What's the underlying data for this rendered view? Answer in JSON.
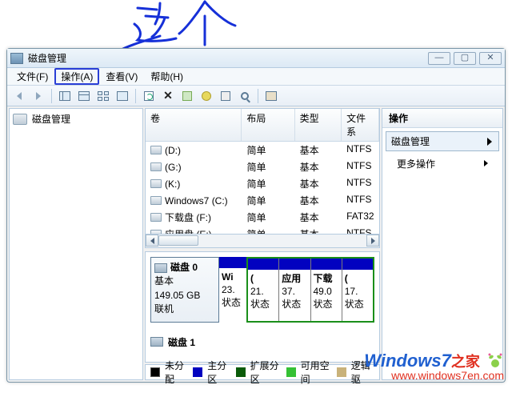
{
  "annotation_text": "这个",
  "window": {
    "title": "磁盘管理",
    "menu": {
      "file": "文件(F)",
      "action": "操作(A)",
      "view": "查看(V)",
      "help": "帮助(H)"
    },
    "tree": {
      "root": "磁盘管理"
    },
    "table": {
      "headers": {
        "volume": "卷",
        "layout": "布局",
        "type": "类型",
        "fs": "文件系"
      },
      "rows": [
        {
          "name": "(D:)",
          "layout": "简单",
          "type": "基本",
          "fs": "NTFS"
        },
        {
          "name": "(G:)",
          "layout": "简单",
          "type": "基本",
          "fs": "NTFS"
        },
        {
          "name": "(K:)",
          "layout": "简单",
          "type": "基本",
          "fs": "NTFS"
        },
        {
          "name": "Windows7 (C:)",
          "layout": "简单",
          "type": "基本",
          "fs": "NTFS"
        },
        {
          "name": "下载盘 (F:)",
          "layout": "简单",
          "type": "基本",
          "fs": "FAT32"
        },
        {
          "name": "应用盘 (E:)",
          "layout": "简单",
          "type": "基本",
          "fs": "NTFS"
        }
      ]
    },
    "disk0": {
      "label": "磁盘 0",
      "kind": "基本",
      "size": "149.05 GB",
      "status": "联机",
      "parts": [
        {
          "name": "Wi",
          "size": "23.",
          "status": "状态"
        },
        {
          "name": "(",
          "size": "21.",
          "status": "状态"
        },
        {
          "name": "应用",
          "size": "37.",
          "status": "状态"
        },
        {
          "name": "下载",
          "size": "49.0",
          "status": "状态"
        },
        {
          "name": "(",
          "size": "17.",
          "status": "状态"
        }
      ]
    },
    "disk1": {
      "label": "磁盘 1"
    },
    "legend": {
      "unalloc": "未分配",
      "primary": "主分区",
      "extended": "扩展分区",
      "free": "可用空间",
      "logical": "逻辑驱"
    },
    "actions": {
      "header": "操作",
      "selected": "磁盘管理",
      "more": "更多操作"
    }
  },
  "watermark": {
    "brand_en": "Windows7",
    "brand_zh": "之家",
    "url": "www.windows7en.com"
  }
}
